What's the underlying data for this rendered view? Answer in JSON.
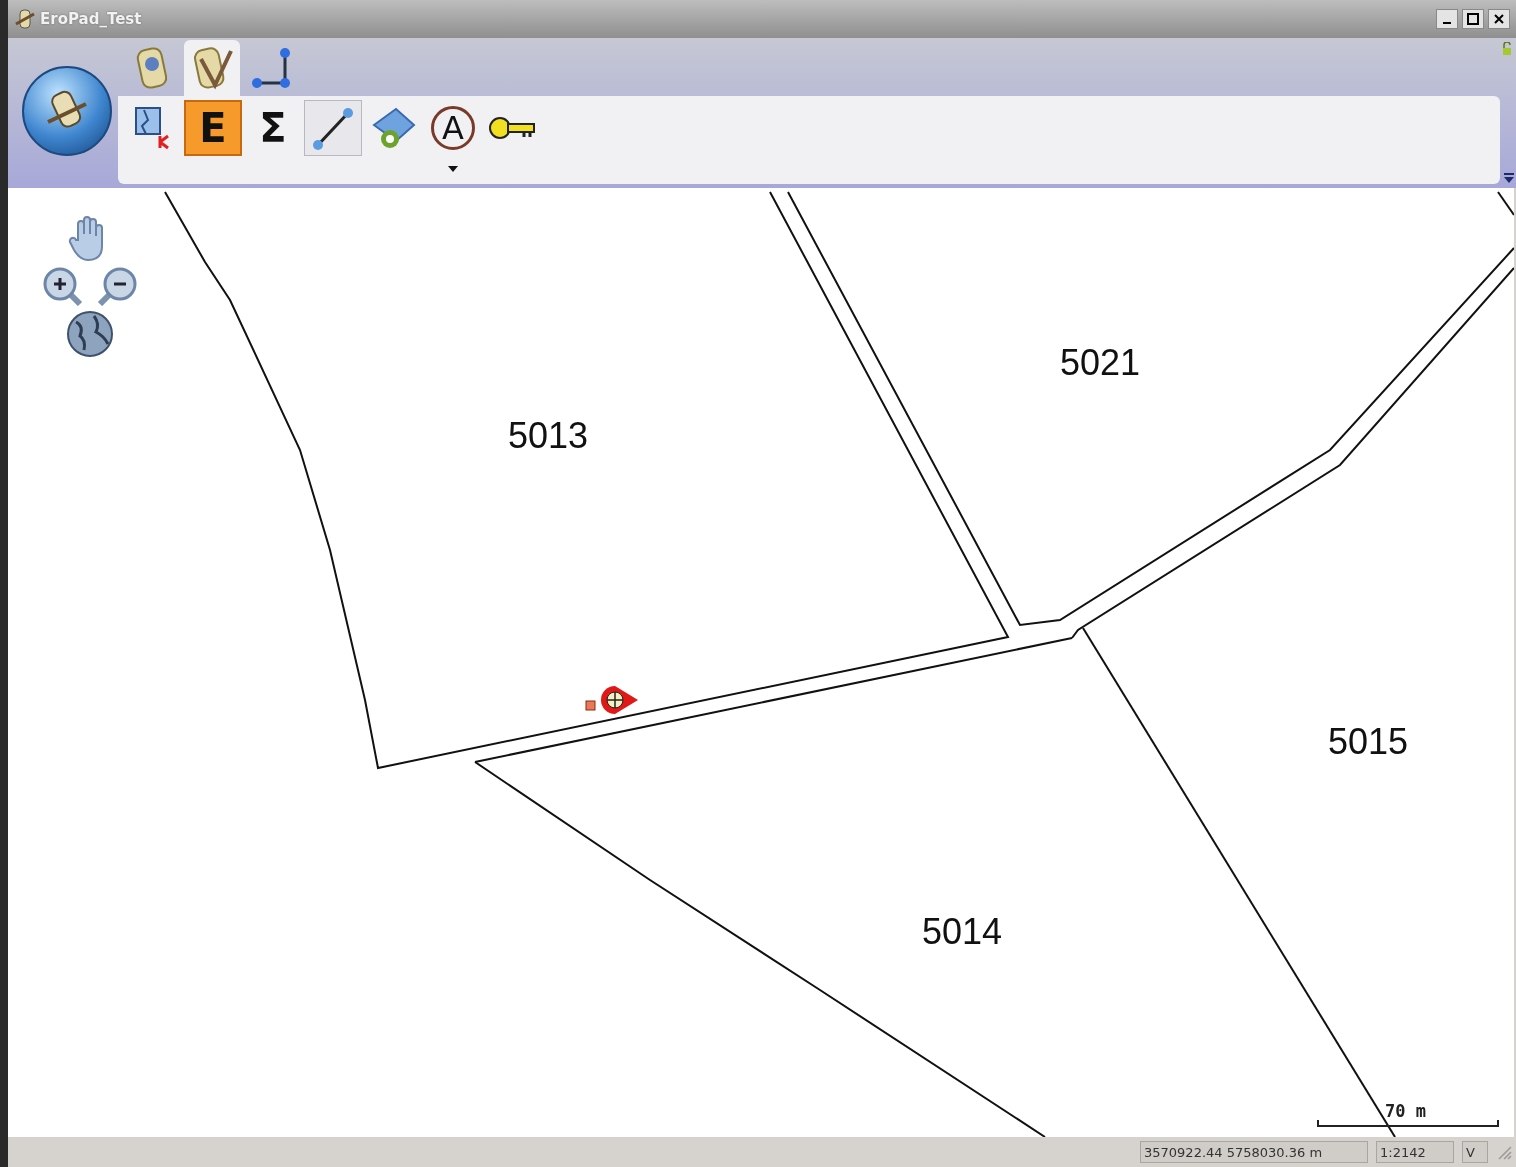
{
  "window": {
    "title": "EroPad_Test"
  },
  "ribbon_tabs": [
    {
      "kind": "gps",
      "selected": false
    },
    {
      "kind": "edit",
      "selected": true
    },
    {
      "kind": "topology",
      "selected": false
    }
  ],
  "tools": [
    {
      "kind": "map-k",
      "selected": false,
      "hover": false
    },
    {
      "kind": "letter",
      "label": "E",
      "selected": true,
      "hover": false
    },
    {
      "kind": "letter",
      "label": "Σ",
      "selected": false,
      "hover": false
    },
    {
      "kind": "line",
      "selected": false,
      "hover": true
    },
    {
      "kind": "add-area",
      "selected": false,
      "hover": false
    },
    {
      "kind": "letter-circle",
      "label": "A",
      "selected": false,
      "hover": false,
      "dropdown": true
    },
    {
      "kind": "key",
      "selected": false,
      "hover": false
    }
  ],
  "map": {
    "parcels": [
      "5013",
      "5021",
      "5015",
      "5014"
    ],
    "scale_bar": "70 m"
  },
  "status_bar": {
    "coordinates": "3570922.44 5758030.36 m",
    "scale": "1:2142",
    "mode": "V"
  }
}
